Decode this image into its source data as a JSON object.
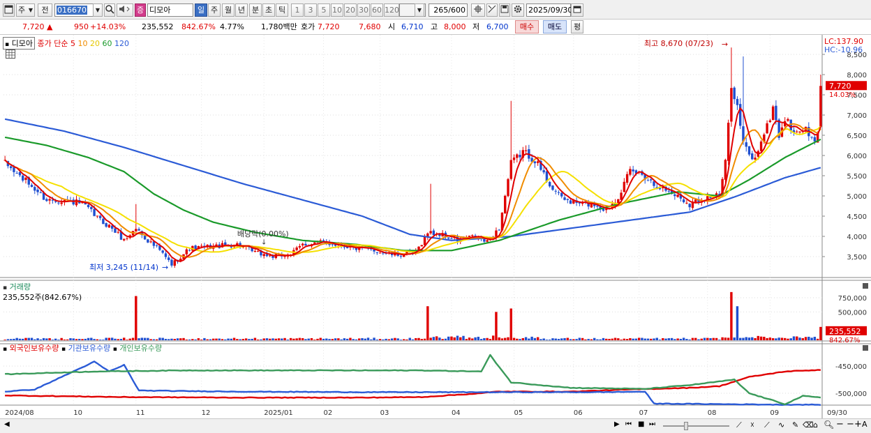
{
  "toolbar": {
    "period_btn": "주",
    "prev_btn": "전",
    "code": "016670",
    "stock_badge": "증",
    "stock_name": "디모아",
    "intervals": [
      "일",
      "주",
      "월",
      "년",
      "분",
      "초",
      "틱"
    ],
    "selected_interval": "일",
    "ticks": [
      "1",
      "3",
      "5",
      "10",
      "20",
      "30",
      "60",
      "120"
    ],
    "count": "265",
    "count_max": "/600",
    "date": "2025/09/30"
  },
  "quote": {
    "price": "7,720",
    "change": "950",
    "change_pct": "+14.03%",
    "volume": "235,552",
    "volume_ratio": "842.67%",
    "turnover": "4.77%",
    "amount": "1,780백만",
    "ask_label": "호가",
    "ask": "7,720",
    "bid": "7,680",
    "open_label": "시",
    "open": "6,710",
    "high_label": "고",
    "high": "8,000",
    "low_label": "저",
    "low": "6,700",
    "buy_btn": "매수",
    "sell_btn": "매도",
    "eval_btn": "평"
  },
  "price_pane": {
    "legend_name": "디모아",
    "legend_label": "종가 단순",
    "ma_labels": [
      "5",
      "10",
      "20",
      "60",
      "120"
    ],
    "lc": "LC:137.90",
    "hc": "HC:-10.96",
    "current_price": "7,720",
    "current_pct": "14.03%",
    "max_note": "최고 8,670 (07/23)",
    "min_note": "최저 3,245 (11/14)",
    "dividend_note": "배당락(0.00%)"
  },
  "volume_pane": {
    "title": "거래량",
    "current": "235,552주(842.67%)",
    "current_value": "235,552",
    "current_pct": "842.67%"
  },
  "holding_pane": {
    "titles": [
      "외국인보유수량",
      "기관보유수량",
      "개인보유수량"
    ]
  },
  "colors": {
    "up": "#e00000",
    "down": "#1f4fd0",
    "ma5": "#e00000",
    "ma10": "#f08c00",
    "ma20": "#f5e000",
    "ma60": "#1a9a2a",
    "ma120": "#2b5bd6",
    "foreign": "#e00000",
    "institution": "#2b5bd6",
    "individual": "#3a9a5a"
  },
  "chart_data": {
    "type": "candlestick",
    "price_axis": [
      3500,
      4000,
      4500,
      5000,
      5500,
      6000,
      6500,
      7000,
      7500,
      8000,
      8500
    ],
    "price_axis_labels": [
      "3,500",
      "4,000",
      "4,500",
      "5,000",
      "5,500",
      "6,000",
      "6,500",
      "7,000",
      "7,500",
      "8,000",
      "8,500"
    ],
    "volume_axis": [
      500000,
      750000
    ],
    "volume_axis_labels": [
      "500,000",
      "750,000"
    ],
    "holding_axis": [
      -500000,
      -450000
    ],
    "holding_axis_labels": [
      "-500,000",
      "-450,000"
    ],
    "x_labels": [
      "2024/08",
      "10",
      "11",
      "12",
      "2025/01",
      "02",
      "03",
      "04",
      "05",
      "06",
      "07",
      "08",
      "09",
      "09/30"
    ],
    "price_path": [
      [
        0,
        5800
      ],
      [
        8,
        5300
      ],
      [
        14,
        4900
      ],
      [
        20,
        4900
      ],
      [
        26,
        4800
      ],
      [
        32,
        4400
      ],
      [
        36,
        4200
      ],
      [
        40,
        3900
      ],
      [
        44,
        4200
      ],
      [
        48,
        3900
      ],
      [
        52,
        3650
      ],
      [
        56,
        3300
      ],
      [
        62,
        3700
      ],
      [
        70,
        3750
      ],
      [
        78,
        3800
      ],
      [
        84,
        3600
      ],
      [
        90,
        3500
      ],
      [
        96,
        3550
      ],
      [
        100,
        3800
      ],
      [
        106,
        3850
      ],
      [
        112,
        3800
      ],
      [
        118,
        3700
      ],
      [
        124,
        3650
      ],
      [
        130,
        3550
      ],
      [
        134,
        3550
      ],
      [
        138,
        3600
      ],
      [
        142,
        4100
      ],
      [
        146,
        4050
      ],
      [
        152,
        3900
      ],
      [
        158,
        4000
      ],
      [
        162,
        3850
      ],
      [
        166,
        4200
      ],
      [
        170,
        5800
      ],
      [
        174,
        6100
      ],
      [
        178,
        5900
      ],
      [
        182,
        5400
      ],
      [
        186,
        5000
      ],
      [
        190,
        4850
      ],
      [
        194,
        4800
      ],
      [
        198,
        4800
      ],
      [
        202,
        4650
      ],
      [
        206,
        5000
      ],
      [
        210,
        5600
      ],
      [
        214,
        5550
      ],
      [
        218,
        5300
      ],
      [
        222,
        5150
      ],
      [
        226,
        5000
      ],
      [
        230,
        4800
      ],
      [
        234,
        4950
      ],
      [
        238,
        5000
      ],
      [
        240,
        5000
      ],
      [
        242,
        5800
      ],
      [
        244,
        7800
      ],
      [
        246,
        7200
      ],
      [
        248,
        6300
      ],
      [
        250,
        6000
      ],
      [
        252,
        5900
      ],
      [
        254,
        6400
      ],
      [
        256,
        6700
      ],
      [
        258,
        7200
      ],
      [
        260,
        6500
      ],
      [
        262,
        6900
      ],
      [
        264,
        6700
      ],
      [
        266,
        6500
      ],
      [
        268,
        6700
      ],
      [
        270,
        6500
      ],
      [
        272,
        6300
      ],
      [
        274,
        6700
      ]
    ],
    "last_bar": {
      "open": 6710,
      "high": 8000,
      "low": 6700,
      "close": 7720
    },
    "spikes": [
      [
        44,
        4800
      ],
      [
        143,
        5300
      ],
      [
        170,
        7350
      ],
      [
        244,
        8670
      ],
      [
        248,
        8450
      ]
    ],
    "ma60": [
      [
        0,
        6450
      ],
      [
        14,
        6250
      ],
      [
        28,
        5950
      ],
      [
        40,
        5600
      ],
      [
        50,
        5050
      ],
      [
        60,
        4650
      ],
      [
        70,
        4350
      ],
      [
        84,
        4100
      ],
      [
        100,
        3900
      ],
      [
        118,
        3800
      ],
      [
        134,
        3650
      ],
      [
        150,
        3650
      ],
      [
        166,
        3900
      ],
      [
        186,
        4400
      ],
      [
        206,
        4800
      ],
      [
        226,
        5100
      ],
      [
        240,
        5000
      ],
      [
        250,
        5400
      ],
      [
        262,
        5950
      ],
      [
        274,
        6400
      ]
    ],
    "ma120": [
      [
        0,
        6900
      ],
      [
        20,
        6600
      ],
      [
        40,
        6200
      ],
      [
        60,
        5750
      ],
      [
        80,
        5300
      ],
      [
        100,
        4900
      ],
      [
        120,
        4500
      ],
      [
        136,
        4050
      ],
      [
        150,
        3900
      ],
      [
        170,
        4000
      ],
      [
        190,
        4200
      ],
      [
        210,
        4400
      ],
      [
        230,
        4600
      ],
      [
        246,
        5000
      ],
      [
        262,
        5450
      ],
      [
        274,
        5700
      ]
    ],
    "volume_spikes": [
      [
        44,
        780000
      ],
      [
        142,
        600000
      ],
      [
        165,
        500000
      ],
      [
        170,
        560000
      ],
      [
        244,
        850000
      ],
      [
        246,
        600000
      ],
      [
        274,
        235552
      ]
    ],
    "series": [
      {
        "name": "외국인보유수량",
        "path": [
          [
            0,
            -504000
          ],
          [
            40,
            -507000
          ],
          [
            80,
            -508000
          ],
          [
            120,
            -508000
          ],
          [
            140,
            -507000
          ],
          [
            160,
            -500000
          ],
          [
            165,
            -497000
          ],
          [
            190,
            -497000
          ],
          [
            210,
            -493000
          ],
          [
            230,
            -490000
          ],
          [
            240,
            -487000
          ],
          [
            250,
            -470000
          ],
          [
            262,
            -460000
          ],
          [
            274,
            -457000
          ]
        ]
      },
      {
        "name": "기관보유수량",
        "path": [
          [
            0,
            -497000
          ],
          [
            10,
            -493000
          ],
          [
            30,
            -442000
          ],
          [
            35,
            -460000
          ],
          [
            40,
            -448000
          ],
          [
            45,
            -495000
          ],
          [
            60,
            -496000
          ],
          [
            80,
            -497000
          ],
          [
            120,
            -498000
          ],
          [
            165,
            -498000
          ],
          [
            200,
            -498000
          ],
          [
            215,
            -497000
          ],
          [
            218,
            -519000
          ],
          [
            240,
            -520000
          ],
          [
            260,
            -521000
          ],
          [
            274,
            -521000
          ]
        ]
      },
      {
        "name": "개인보유수량",
        "path": [
          [
            0,
            -465000
          ],
          [
            30,
            -460000
          ],
          [
            60,
            -458000
          ],
          [
            100,
            -458000
          ],
          [
            140,
            -458000
          ],
          [
            160,
            -460000
          ],
          [
            163,
            -430000
          ],
          [
            170,
            -480000
          ],
          [
            190,
            -490000
          ],
          [
            215,
            -492000
          ],
          [
            230,
            -485000
          ],
          [
            245,
            -475000
          ],
          [
            250,
            -500000
          ],
          [
            262,
            -520000
          ],
          [
            268,
            -505000
          ],
          [
            274,
            -508000
          ]
        ]
      }
    ]
  }
}
